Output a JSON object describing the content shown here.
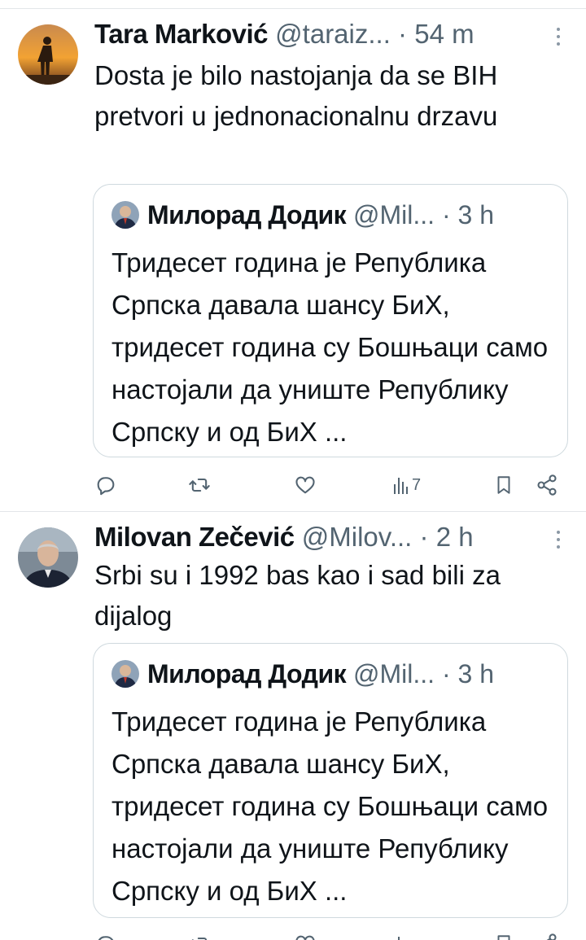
{
  "tweets": [
    {
      "author_name": "Tara Marković",
      "handle": "@taraiz...",
      "separator": "·",
      "time": "54 m",
      "text": "Dosta je bilo nastojanja da se BIH pretvori u jednonacionalnu drzavu",
      "quote": {
        "author_name": "Милорад Додик",
        "handle": "@Mil...",
        "separator": "·",
        "time": "3 h",
        "text": "Тридесет година је Република Српска давала шансу БиХ, тридесет година су Бошњаци само настојали да униште Републику Српску и од БиХ ..."
      },
      "actions": {
        "views_count": "7"
      }
    },
    {
      "author_name": "Milovan Zečević",
      "handle": "@Milov...",
      "separator": "·",
      "time": "2 h",
      "text": "Srbi su i 1992 bas kao i sad bili za dijalog",
      "quote": {
        "author_name": "Милорад Додик",
        "handle": "@Mil...",
        "separator": "·",
        "time": "3 h",
        "text": "Тридесет година је Република Српска давала шансу БиХ, тридесет година су Бошњаци само настојали да униште Републику Српску и од БиХ ..."
      }
    }
  ],
  "icons": {
    "reply": "reply-icon",
    "retweet": "retweet-icon",
    "like": "heart-icon",
    "views": "views-chart-icon",
    "bookmark": "bookmark-icon",
    "share": "share-icon",
    "more": "more-vertical-icon"
  },
  "colors": {
    "text": "#0f1419",
    "secondary_text": "#536471",
    "border": "#cfd9de",
    "divider": "#e3e6e9"
  }
}
